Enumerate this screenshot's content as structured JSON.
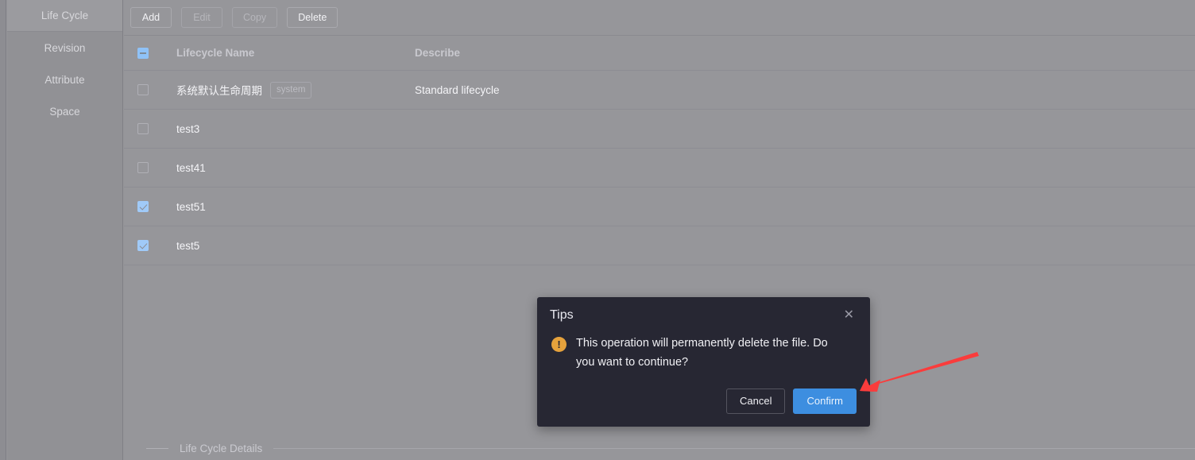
{
  "sidebar": {
    "items": [
      {
        "label": "Life Cycle",
        "active": true
      },
      {
        "label": "Revision",
        "active": false
      },
      {
        "label": "Attribute",
        "active": false
      },
      {
        "label": "Space",
        "active": false
      }
    ]
  },
  "toolbar": {
    "add_label": "Add",
    "edit_label": "Edit",
    "copy_label": "Copy",
    "delete_label": "Delete"
  },
  "table": {
    "headers": {
      "name": "Lifecycle Name",
      "describe": "Describe"
    },
    "select_all_state": "indeterminate",
    "rows": [
      {
        "checked": false,
        "name": "系统默认生命周期",
        "tag": "system",
        "describe": "Standard lifecycle"
      },
      {
        "checked": false,
        "name": "test3",
        "tag": "",
        "describe": ""
      },
      {
        "checked": false,
        "name": "test41",
        "tag": "",
        "describe": ""
      },
      {
        "checked": true,
        "name": "test51",
        "tag": "",
        "describe": ""
      },
      {
        "checked": true,
        "name": "test5",
        "tag": "",
        "describe": ""
      }
    ]
  },
  "details": {
    "label": "Life Cycle Details"
  },
  "modal": {
    "title": "Tips",
    "close_icon": "✕",
    "warn_icon": "!",
    "message": "This operation will permanently delete the file. Do you want to continue?",
    "cancel_label": "Cancel",
    "confirm_label": "Confirm"
  },
  "annotation": {
    "arrow_color": "#fa3c3c"
  },
  "colors": {
    "page_bg": "#96969a",
    "sidebar_bg": "#919195",
    "sidebar_active_bg": "#9b9b9f",
    "modal_bg": "#272733",
    "confirm_blue": "#3d8ee0",
    "checkbox_blue": "#a0caf8",
    "warn_orange": "#e6a23c"
  }
}
